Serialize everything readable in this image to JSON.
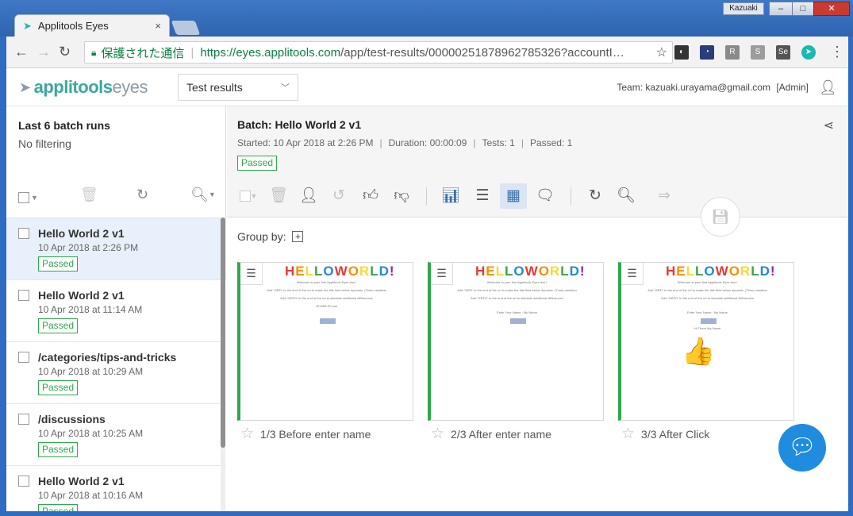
{
  "browser": {
    "tab_title": "Applitools Eyes",
    "tab_close": "×",
    "window_user": "Kazuaki",
    "window_controls": [
      "–",
      "□",
      "✕"
    ],
    "secure_label": "保護された通信",
    "url_base": "https://eyes.applitools.com",
    "url_rest": "/app/test-results/00000251878962785326?accountI…",
    "extensions": [
      "incognito-icon",
      "speed-icon",
      "rw-icon",
      "s-icon",
      "se-icon",
      "applitools-icon"
    ]
  },
  "app": {
    "logo_main": "applitools",
    "logo_sub": "eyes",
    "view_select": "Test results",
    "team_text": "Team: kazuaki.urayama@gmail.com",
    "role_text": "[Admin]"
  },
  "sidebar": {
    "title": "Last 6 batch runs",
    "filter": "No filtering",
    "batches": [
      {
        "name": "Hello World 2 v1",
        "date": "10 Apr 2018 at 2:26 PM",
        "status": "Passed"
      },
      {
        "name": "Hello World 2 v1",
        "date": "10 Apr 2018 at 11:14 AM",
        "status": "Passed"
      },
      {
        "name": "/categories/tips-and-tricks",
        "date": "10 Apr 2018 at 10:29 AM",
        "status": "Passed"
      },
      {
        "name": "/discussions",
        "date": "10 Apr 2018 at 10:25 AM",
        "status": "Passed"
      },
      {
        "name": "Hello World 2 v1",
        "date": "10 Apr 2018 at 10:16 AM",
        "status": "Passed"
      }
    ]
  },
  "batch": {
    "title": "Batch: Hello World 2 v1",
    "started": "Started: 10 Apr 2018 at 2:26 PM",
    "duration": "Duration: 00:00:09",
    "tests": "Tests: 1",
    "passed": "Passed: 1",
    "status": "Passed",
    "group_by": "Group by:"
  },
  "steps": [
    {
      "caption": "1/3 Before enter name",
      "has_thumb": false
    },
    {
      "caption": "2/3 After enter name",
      "has_thumb": false
    },
    {
      "caption": "3/3 After Click",
      "has_thumb": true
    }
  ],
  "snapshot": {
    "heading": "HELLO WORLD!",
    "line1": "Welcome to your first Applitools Eyes test !",
    "line2": "Add '%RFI' to the end of the url to make the title field below dynamic. (Time) variation",
    "line3": "Add '%RFO' to the end of the url to simulate additional differences",
    "line4": "HH:MM:SS.sss",
    "line5": "Enter Your Name : My Name",
    "line6": "Hi There My Name"
  },
  "colors": {
    "accent": "#3aa89b",
    "passed": "#2ea84a",
    "chat": "#1f8ce0"
  }
}
